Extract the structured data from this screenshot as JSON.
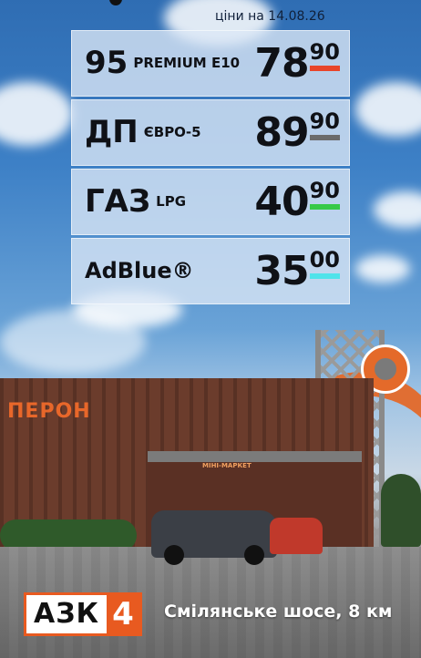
{
  "header": {
    "price_date": "ціни на 14.08.26"
  },
  "prices": [
    {
      "fuel": "95",
      "grade": "PREMIUM E10",
      "int": "78",
      "frac": "90",
      "bar_color": "#e8452a"
    },
    {
      "fuel": "ДП",
      "grade": "ЄВРО-5",
      "int": "89",
      "frac": "90",
      "bar_color": "#6b6b6b"
    },
    {
      "fuel": "ГАЗ",
      "grade": "LPG",
      "int": "40",
      "frac": "90",
      "bar_color": "#37c947"
    },
    {
      "fuel": "AdBlue®",
      "grade": "",
      "int": "35",
      "frac": "00",
      "bar_color": "#4fe3ea"
    }
  ],
  "scene": {
    "building_sign": "ПЕРОН",
    "shop_sign": "МІНІ-МАРКЕТ"
  },
  "footer": {
    "logo_text": "АЗК",
    "logo_number": "4",
    "address": "Смілянське шосе, 8 км"
  },
  "colors": {
    "brand_orange": "#e85a20"
  }
}
